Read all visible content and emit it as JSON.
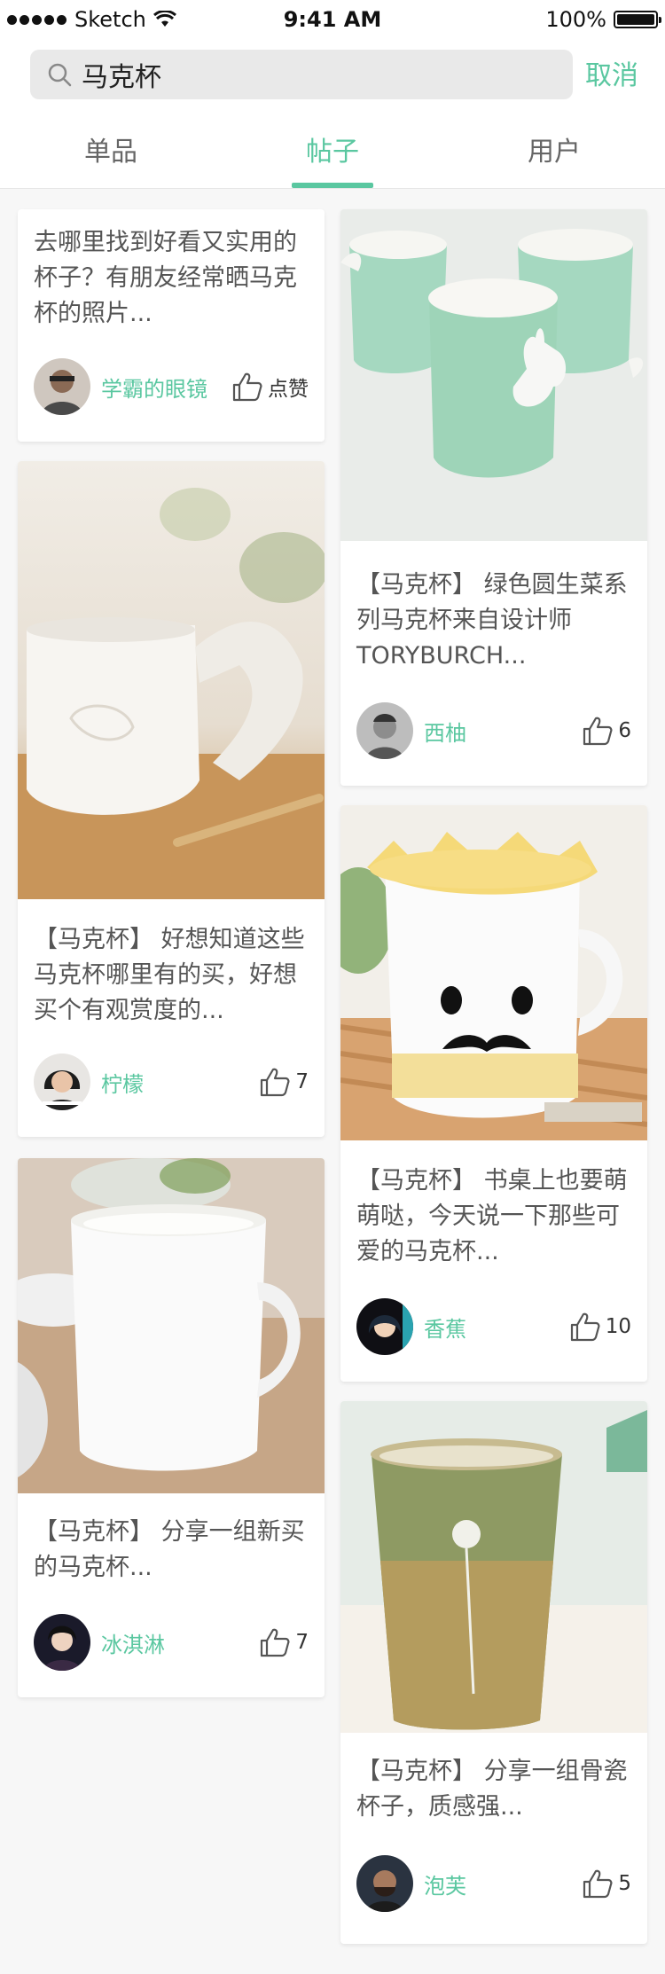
{
  "status": {
    "carrier": "Sketch",
    "time": "9:41 AM",
    "battery": "100%"
  },
  "search": {
    "value": "马克杯",
    "cancel": "取消"
  },
  "tabs": [
    {
      "label": "单品",
      "active": false
    },
    {
      "label": "帖子",
      "active": true
    },
    {
      "label": "用户",
      "active": false
    }
  ],
  "posts": [
    {
      "title": "去哪里找到好看又实用的杯子？有朋友经常晒马克杯的照片...",
      "user": "学霸的眼镜",
      "likes": "点赞"
    },
    {
      "title": "【马克杯】  好想知道这些马克杯哪里有的买，好想买个有观赏度的...",
      "user": "柠檬",
      "likes": "7"
    },
    {
      "title": "【马克杯】  分享一组新买的马克杯...",
      "user": "冰淇淋",
      "likes": "7"
    },
    {
      "title": "【马克杯】  绿色圆生菜系列马克杯来自设计师TORYBURCH...",
      "user": "西柚",
      "likes": "6"
    },
    {
      "title": "【马克杯】  书桌上也要萌萌哒，今天说一下那些可爱的马克杯...",
      "user": "香蕉",
      "likes": "10"
    },
    {
      "title": "【马克杯】  分享一组骨瓷杯子，质感强...",
      "user": "泡芙",
      "likes": "5"
    }
  ],
  "colors": {
    "accent": "#5ac7a0",
    "background": "#f7f7f7"
  }
}
